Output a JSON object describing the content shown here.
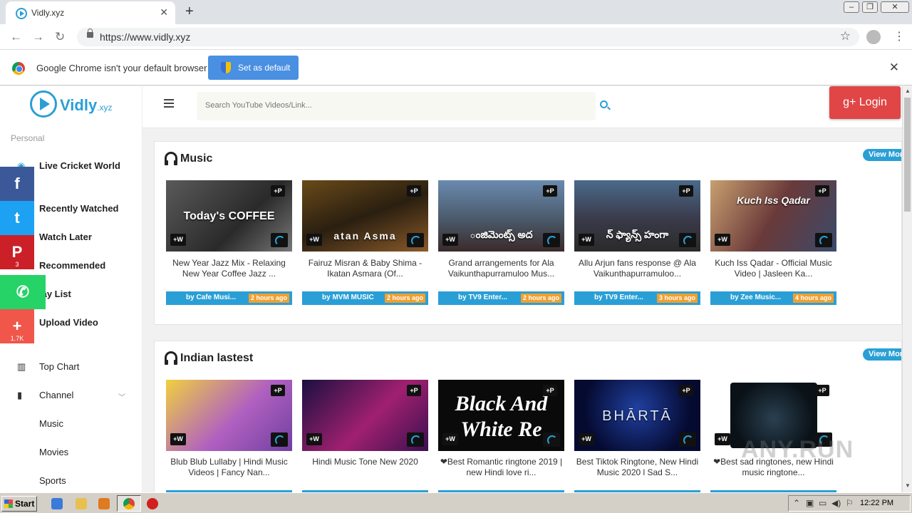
{
  "browser": {
    "tab_title": "Vidly.xyz",
    "tab_close": "✕",
    "new_tab": "+",
    "url": "https://www.vidly.xyz",
    "infobar_text": "Google Chrome isn't your default browser",
    "set_default_label": "Set as default",
    "infobar_close": "✕"
  },
  "site": {
    "logo_name": "Vidly",
    "logo_tld": ".xyz",
    "search_placeholder": "Search YouTube Videos/Link...",
    "login_label": "g+ Login"
  },
  "sidebar": {
    "section_label": "Personal",
    "items": [
      {
        "label": "Live Cricket World"
      },
      {
        "label": "Recently Watched"
      },
      {
        "label": "Watch Later"
      },
      {
        "label": "Recommended"
      },
      {
        "label": "lay List"
      },
      {
        "label": "Upload Video"
      },
      {
        "label": "Top Chart"
      },
      {
        "label": "Channel"
      },
      {
        "label": "Music"
      },
      {
        "label": "Movies"
      },
      {
        "label": "Sports"
      }
    ]
  },
  "social": [
    {
      "name": "facebook",
      "glyph": "f",
      "color": "#3b5998",
      "count": ""
    },
    {
      "name": "twitter",
      "glyph": "t",
      "color": "#1da1f2",
      "count": ""
    },
    {
      "name": "pinterest",
      "glyph": "P",
      "color": "#cb2027",
      "count": "3"
    },
    {
      "name": "whatsapp",
      "glyph": "✆",
      "color": "#25d366",
      "count": ""
    },
    {
      "name": "share",
      "glyph": "+",
      "color": "#f0564a",
      "count": "1.7K"
    }
  ],
  "sections": [
    {
      "title": "Music",
      "view_more": "View More",
      "cards": [
        {
          "thumb_text": "Today's COFFEE",
          "title": "New Year Jazz Mix - Relaxing New Year Coffee Jazz ...",
          "by": "by Cafe Musi...",
          "time": "2 hours ago"
        },
        {
          "thumb_text": "atan Asma",
          "title": "Fairuz Misran & Baby Shima - Ikatan Asmara (Of...",
          "by": "by MVM MUSIC",
          "time": "2 hours ago"
        },
        {
          "thumb_text": "ంజిమెంట్స్ అద",
          "title": "Grand arrangements for Ala Vaikunthapurramuloo Mus...",
          "by": "by TV9 Enter...",
          "time": "2 hours ago"
        },
        {
          "thumb_text": "న్ ఫ్యాన్స్ హంగా",
          "title": "Allu Arjun fans response @ Ala Vaikunthapurramuloo...",
          "by": "by TV9 Enter...",
          "time": "3 hours ago"
        },
        {
          "thumb_text": "Kuch Iss Qadar",
          "title": "Kuch Iss Qadar - Official Music Video | Jasleen Ka...",
          "by": "by Zee Music...",
          "time": "4 hours ago"
        }
      ]
    },
    {
      "title": "Indian lastest",
      "view_more": "View More",
      "cards": [
        {
          "thumb_text": "",
          "title": "Blub Blub Lullaby | Hindi Music Videos | Fancy Nan...",
          "by": "",
          "time": ""
        },
        {
          "thumb_text": "",
          "title": "Hindi Music Tone New 2020",
          "by": "",
          "time": ""
        },
        {
          "thumb_text": "Black And White Re",
          "title": "❤Best Romantic ringtone 2019 | new Hindi love ri...",
          "by": "",
          "time": ""
        },
        {
          "thumb_text": "BHĀRTĀ",
          "title": "Best Tiktok Ringtone, New Hindi Music 2020 l Sad S...",
          "by": "",
          "time": ""
        },
        {
          "thumb_text": "",
          "title": "❤Best sad ringtones, new Hindi music ringtone...",
          "by": "",
          "time": ""
        }
      ]
    }
  ],
  "taskbar": {
    "start_label": "Start",
    "clock": "12:22 PM"
  },
  "watermark": "ANY.RUN"
}
